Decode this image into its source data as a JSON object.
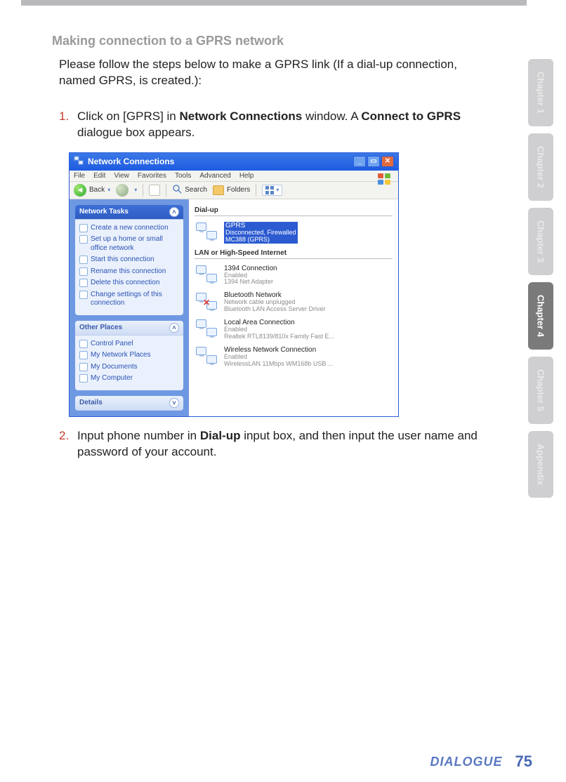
{
  "section_title": "Making connection to a GPRS network",
  "intro": "Please follow the steps below to make a GPRS link (If a dial-up connection, named GPRS, is created.):",
  "steps": [
    {
      "num": "1.",
      "pre": "Click on [GPRS] in ",
      "b1": "Network Connections",
      "mid": " window. A ",
      "b2": "Connect to GPRS",
      "post": " dialogue box appears."
    },
    {
      "num": "2.",
      "pre": "Input phone number in ",
      "b1": "Dial-up",
      "mid": " input box, and then input the user name and password of your account.",
      "b2": "",
      "post": ""
    }
  ],
  "tabs": [
    "Chapter 1",
    "Chapter 2",
    "Chapter 3",
    "Chapter 4",
    "Chapter 5",
    "Appendix"
  ],
  "active_tab_index": 3,
  "footer": {
    "brand": "DIALOGUE",
    "page": "75"
  },
  "win": {
    "title": "Network Connections",
    "menu": [
      "File",
      "Edit",
      "View",
      "Favorites",
      "Tools",
      "Advanced",
      "Help"
    ],
    "toolbar": {
      "back": "Back",
      "search": "Search",
      "folders": "Folders"
    },
    "side": {
      "tasks_head": "Network Tasks",
      "tasks": [
        "Create a new connection",
        "Set up a home or small office network",
        "Start this connection",
        "Rename this connection",
        "Delete this connection",
        "Change settings of this connection"
      ],
      "places_head": "Other Places",
      "places": [
        "Control Panel",
        "My Network Places",
        "My Documents",
        "My Computer"
      ],
      "details_head": "Details"
    },
    "groups": {
      "dialup": {
        "head": "Dial-up",
        "items": [
          {
            "name": "GPRS",
            "status": "Disconnected, Firewalled",
            "device": "MC388 (GPRS)",
            "selected": true
          }
        ]
      },
      "lan": {
        "head": "LAN or High-Speed Internet",
        "items": [
          {
            "name": "1394 Connection",
            "status": "Enabled",
            "device": "1394 Net Adapter",
            "selected": false,
            "x": false
          },
          {
            "name": "Bluetooth Network",
            "status": "Network cable unplugged",
            "device": "Bluetooth LAN Access Server Driver",
            "selected": false,
            "x": true
          },
          {
            "name": "Local Area Connection",
            "status": "Enabled",
            "device": "Realtek RTL8139/810x Family Fast E...",
            "selected": false,
            "x": false
          },
          {
            "name": "Wireless Network Connection",
            "status": "Enabled",
            "device": "WirelessLAN 11Mbps WM168b USB ...",
            "selected": false,
            "x": false
          }
        ]
      }
    }
  }
}
